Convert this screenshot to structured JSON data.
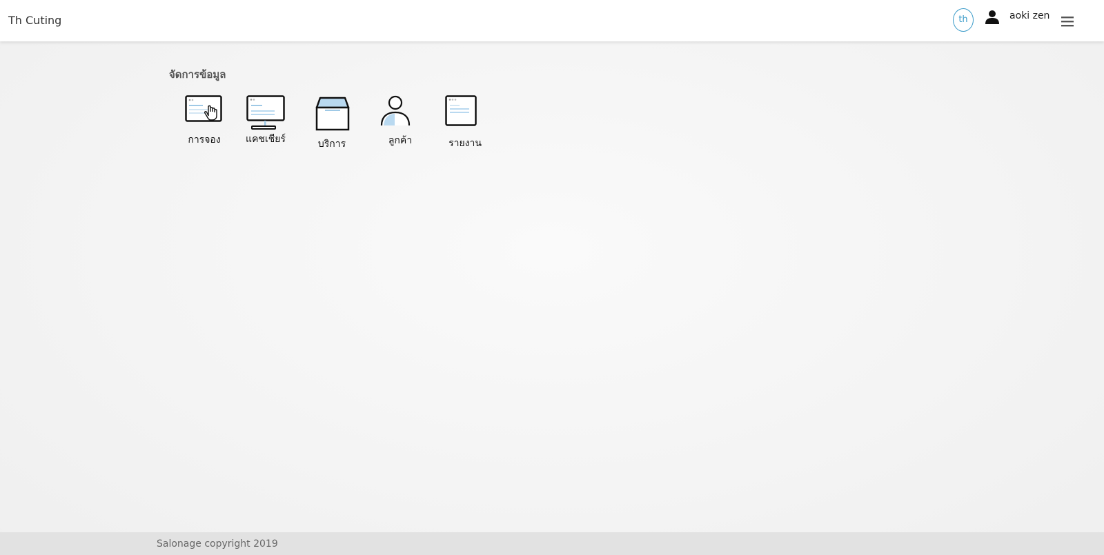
{
  "header": {
    "brand": "Th Cuting",
    "language": "th",
    "user_name": "aoki zen"
  },
  "icons": {
    "user": "user-icon",
    "menu": "hamburger-menu-icon"
  },
  "main": {
    "section_title": "จัดการข้อมูล",
    "tiles": [
      {
        "label": "การจอง",
        "icon": "booking-icon"
      },
      {
        "label": "แคชเชียร์",
        "icon": "cashier-monitor-icon"
      },
      {
        "label": "บริการ",
        "icon": "service-box-icon"
      },
      {
        "label": "ลูกค้า",
        "icon": "customer-icon"
      },
      {
        "label": "รายงาน",
        "icon": "report-icon"
      }
    ]
  },
  "footer": {
    "text": "Salonage copyright 2019"
  },
  "colors": {
    "accent": "#3a9bc9",
    "icon_fill": "#b9d9f0",
    "header_bg": "#ffffff",
    "footer_bg": "#e2e2e2"
  }
}
